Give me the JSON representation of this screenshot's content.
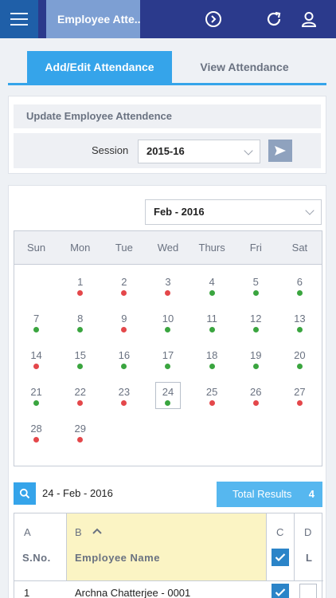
{
  "header": {
    "title": "Employee Atte...",
    "icons": [
      "menu-icon",
      "forward-circle-icon",
      "refresh-icon",
      "user-icon"
    ]
  },
  "tabs": [
    {
      "label": "Add/Edit Attendance",
      "active": true
    },
    {
      "label": "View Attendance",
      "active": false
    }
  ],
  "update_section": {
    "title": "Update Employee Attendence",
    "session_label": "Session",
    "session_value": "2015-16"
  },
  "calendar": {
    "month_value": "Feb - 2016",
    "weekdays": [
      "Sun",
      "Mon",
      "Tue",
      "Wed",
      "Thurs",
      "Fri",
      "Sat"
    ],
    "first_weekday_index": 1,
    "selected_day": 24,
    "days": [
      {
        "num": "1",
        "status": "absent"
      },
      {
        "num": "2",
        "status": "absent"
      },
      {
        "num": "3",
        "status": "absent"
      },
      {
        "num": "4",
        "status": "present"
      },
      {
        "num": "5",
        "status": "present"
      },
      {
        "num": "6",
        "status": "present"
      },
      {
        "num": "7",
        "status": "present"
      },
      {
        "num": "8",
        "status": "present"
      },
      {
        "num": "9",
        "status": "absent"
      },
      {
        "num": "10",
        "status": "present"
      },
      {
        "num": "11",
        "status": "present"
      },
      {
        "num": "12",
        "status": "present"
      },
      {
        "num": "13",
        "status": "present"
      },
      {
        "num": "14",
        "status": "absent"
      },
      {
        "num": "15",
        "status": "present"
      },
      {
        "num": "16",
        "status": "present"
      },
      {
        "num": "17",
        "status": "present"
      },
      {
        "num": "18",
        "status": "present"
      },
      {
        "num": "19",
        "status": "present"
      },
      {
        "num": "20",
        "status": "present"
      },
      {
        "num": "21",
        "status": "present"
      },
      {
        "num": "22",
        "status": "absent"
      },
      {
        "num": "23",
        "status": "absent"
      },
      {
        "num": "24",
        "status": "present"
      },
      {
        "num": "25",
        "status": "absent"
      },
      {
        "num": "26",
        "status": "absent"
      },
      {
        "num": "27",
        "status": "absent"
      },
      {
        "num": "28",
        "status": "absent"
      },
      {
        "num": "29",
        "status": "absent"
      }
    ],
    "colors": {
      "present": "#3aa53f",
      "absent": "#e4474a"
    }
  },
  "results": {
    "selected_date": "24 - Feb - 2016",
    "total_label": "Total Results",
    "total_count": "4"
  },
  "table": {
    "columns": [
      {
        "letter": "A",
        "label": "S.No."
      },
      {
        "letter": "B",
        "label": "Employee Name"
      },
      {
        "letter": "C",
        "label": ""
      },
      {
        "letter": "D",
        "label": "L"
      }
    ],
    "rows": [
      {
        "sno": "1",
        "name": "Archna Chatterjee - 0001",
        "c_checked": true,
        "d_checked": false
      }
    ]
  },
  "colors": {
    "header_bg": "#2b3a8c",
    "accent": "#35a4ea",
    "sort_column_bg": "#fbf4c4"
  }
}
